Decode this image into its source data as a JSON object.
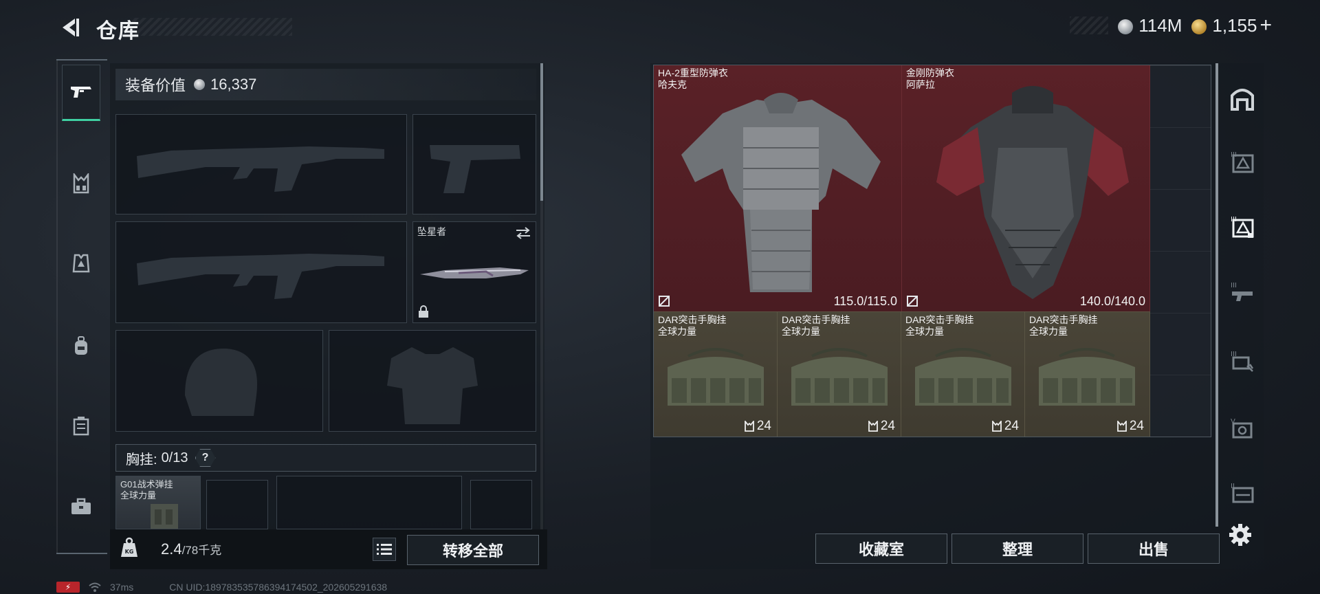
{
  "header": {
    "title": "仓库",
    "currency_silver": "114M",
    "currency_gold": "1,155",
    "add_symbol": "+"
  },
  "left_panel": {
    "equip_value_label": "装备价值",
    "equip_value": "16,337",
    "knife_label": "坠星者",
    "chest_rig_label": "胸挂:",
    "chest_rig_count": "0/13",
    "help_symbol": "?",
    "chest_rig_item_name": "G01战术弹挂",
    "chest_rig_item_brand": "全球力量",
    "weight_value": "2.4",
    "weight_capacity": "/78千克",
    "transfer_all_label": "转移全部"
  },
  "items": [
    {
      "name": "HA-2重型防弹衣",
      "brand": "哈夫克",
      "durability": "115.0/115.0"
    },
    {
      "name": "金刚防弹衣",
      "brand": "阿萨拉",
      "durability": "140.0/140.0"
    },
    {
      "name": "DAR突击手胸挂",
      "brand": "全球力量",
      "capacity": "24"
    },
    {
      "name": "DAR突击手胸挂",
      "brand": "全球力量",
      "capacity": "24"
    },
    {
      "name": "DAR突击手胸挂",
      "brand": "全球力量",
      "capacity": "24"
    },
    {
      "name": "DAR突击手胸挂",
      "brand": "全球力量",
      "capacity": "24"
    }
  ],
  "actions": {
    "collection_label": "收藏室",
    "sort_label": "整理",
    "sell_label": "出售"
  },
  "status": {
    "ping": "37ms",
    "uid": "CN UID:189783535786394174502_202605291638"
  },
  "colors": {
    "accent": "#3fd0a2",
    "armor_bg": "#5a2127",
    "rig_bg": "#4a4538"
  }
}
